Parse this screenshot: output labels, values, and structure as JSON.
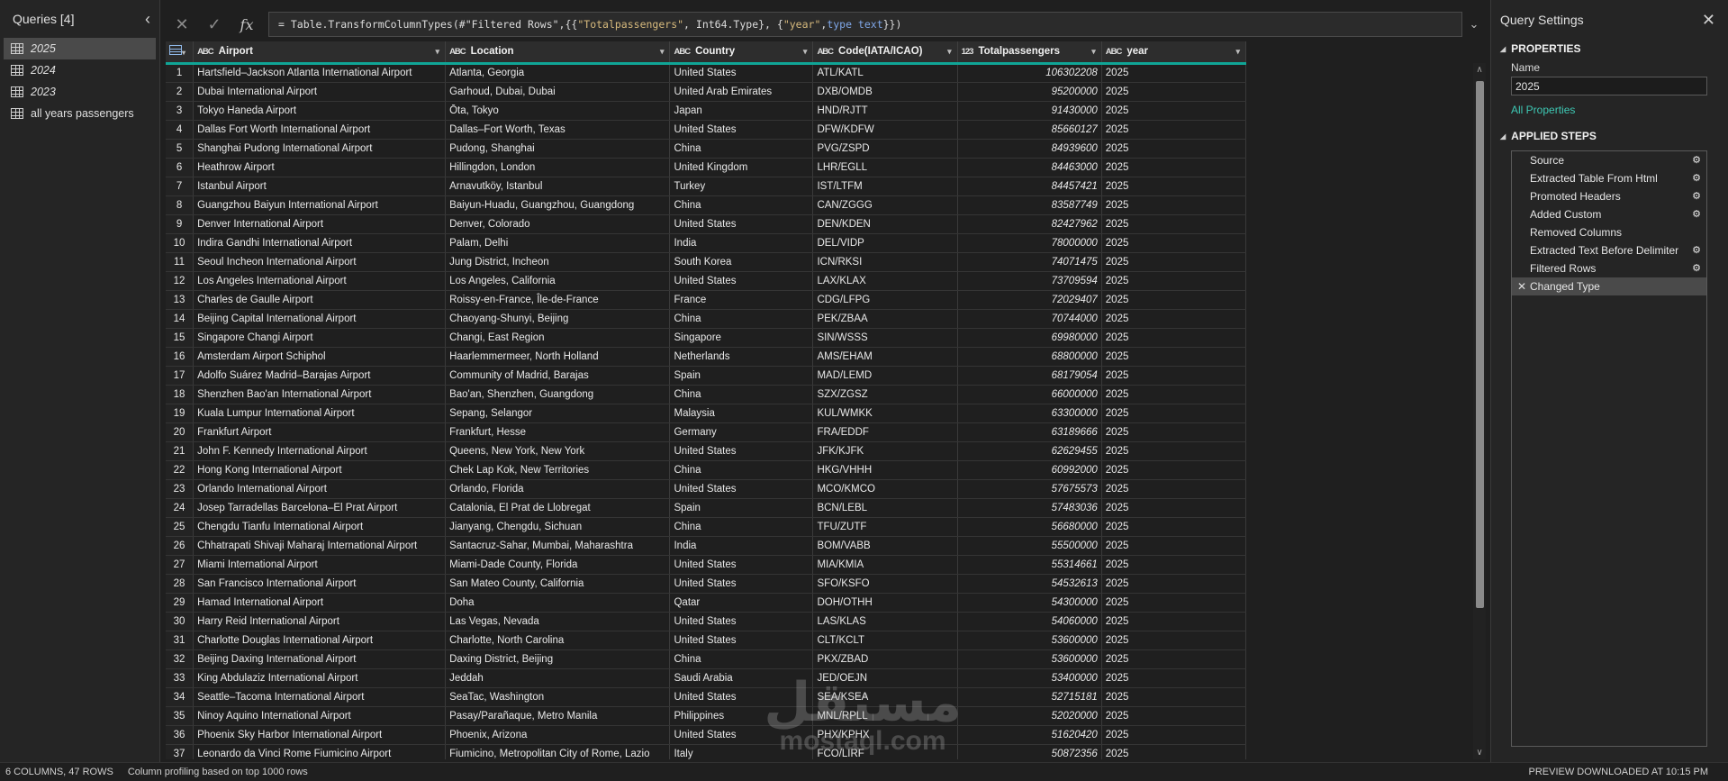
{
  "queries_pane": {
    "title": "Queries [4]",
    "items": [
      {
        "label": "2025",
        "selected": true
      },
      {
        "label": "2024",
        "selected": false
      },
      {
        "label": "2023",
        "selected": false
      },
      {
        "label": "all years passengers",
        "selected": false
      }
    ]
  },
  "formula_bar": {
    "cancel_icon": "x-icon",
    "commit_icon": "check-icon",
    "fx_label": "fx",
    "formula_prefix": "= Table.TransformColumnTypes(#\"Filtered Rows\",{{",
    "formula_str1": "\"Totalpassengers\"",
    "formula_mid": ", Int64.Type}, {",
    "formula_str2": "\"year\"",
    "formula_sep": ", ",
    "formula_kw": "type text",
    "formula_suffix": "}})"
  },
  "columns": [
    {
      "type": "ABC",
      "name": "Airport"
    },
    {
      "type": "ABC",
      "name": "Location"
    },
    {
      "type": "ABC",
      "name": "Country"
    },
    {
      "type": "ABC",
      "name": "Code(IATA/ICAO)"
    },
    {
      "type": "123",
      "name": "Totalpassengers"
    },
    {
      "type": "ABC",
      "name": "year"
    }
  ],
  "rows": [
    [
      "1",
      "Hartsfield–Jackson Atlanta International Airport",
      "Atlanta, Georgia",
      "United States",
      "ATL/KATL",
      "106302208",
      "2025"
    ],
    [
      "2",
      "Dubai International Airport",
      "Garhoud, Dubai, Dubai",
      "United Arab Emirates",
      "DXB/OMDB",
      "95200000",
      "2025"
    ],
    [
      "3",
      "Tokyo Haneda Airport",
      "Ōta, Tokyo",
      "Japan",
      "HND/RJTT",
      "91430000",
      "2025"
    ],
    [
      "4",
      "Dallas Fort Worth International Airport",
      "Dallas–Fort Worth, Texas",
      "United States",
      "DFW/KDFW",
      "85660127",
      "2025"
    ],
    [
      "5",
      "Shanghai Pudong International Airport",
      "Pudong, Shanghai",
      "China",
      "PVG/ZSPD",
      "84939600",
      "2025"
    ],
    [
      "6",
      "Heathrow Airport",
      "Hillingdon, London",
      "United Kingdom",
      "LHR/EGLL",
      "84463000",
      "2025"
    ],
    [
      "7",
      "Istanbul Airport",
      "Arnavutköy, Istanbul",
      "Turkey",
      "IST/LTFM",
      "84457421",
      "2025"
    ],
    [
      "8",
      "Guangzhou Baiyun International Airport",
      "Baiyun-Huadu, Guangzhou, Guangdong",
      "China",
      "CAN/ZGGG",
      "83587749",
      "2025"
    ],
    [
      "9",
      "Denver International Airport",
      "Denver, Colorado",
      "United States",
      "DEN/KDEN",
      "82427962",
      "2025"
    ],
    [
      "10",
      "Indira Gandhi International Airport",
      "Palam, Delhi",
      "India",
      "DEL/VIDP",
      "78000000",
      "2025"
    ],
    [
      "11",
      "Seoul Incheon International Airport",
      "Jung District, Incheon",
      "South Korea",
      "ICN/RKSI",
      "74071475",
      "2025"
    ],
    [
      "12",
      "Los Angeles International Airport",
      "Los Angeles, California",
      "United States",
      "LAX/KLAX",
      "73709594",
      "2025"
    ],
    [
      "13",
      "Charles de Gaulle Airport",
      "Roissy-en-France, Île-de-France",
      "France",
      "CDG/LFPG",
      "72029407",
      "2025"
    ],
    [
      "14",
      "Beijing Capital International Airport",
      "Chaoyang-Shunyi, Beijing",
      "China",
      "PEK/ZBAA",
      "70744000",
      "2025"
    ],
    [
      "15",
      "Singapore Changi Airport",
      "Changi, East Region",
      "Singapore",
      "SIN/WSSS",
      "69980000",
      "2025"
    ],
    [
      "16",
      "Amsterdam Airport Schiphol",
      "Haarlemmermeer, North Holland",
      "Netherlands",
      "AMS/EHAM",
      "68800000",
      "2025"
    ],
    [
      "17",
      "Adolfo Suárez Madrid–Barajas Airport",
      "Community of Madrid, Barajas",
      "Spain",
      "MAD/LEMD",
      "68179054",
      "2025"
    ],
    [
      "18",
      "Shenzhen Bao'an International Airport",
      "Bao'an, Shenzhen, Guangdong",
      "China",
      "SZX/ZGSZ",
      "66000000",
      "2025"
    ],
    [
      "19",
      "Kuala Lumpur International Airport",
      "Sepang, Selangor",
      "Malaysia",
      "KUL/WMKK",
      "63300000",
      "2025"
    ],
    [
      "20",
      "Frankfurt Airport",
      "Frankfurt, Hesse",
      "Germany",
      "FRA/EDDF",
      "63189666",
      "2025"
    ],
    [
      "21",
      "John F. Kennedy International Airport",
      "Queens, New York, New York",
      "United States",
      "JFK/KJFK",
      "62629455",
      "2025"
    ],
    [
      "22",
      "Hong Kong International Airport",
      "Chek Lap Kok, New Territories",
      "China",
      "HKG/VHHH",
      "60992000",
      "2025"
    ],
    [
      "23",
      "Orlando International Airport",
      "Orlando, Florida",
      "United States",
      "MCO/KMCO",
      "57675573",
      "2025"
    ],
    [
      "24",
      "Josep Tarradellas Barcelona–El Prat Airport",
      "Catalonia, El Prat de Llobregat",
      "Spain",
      "BCN/LEBL",
      "57483036",
      "2025"
    ],
    [
      "25",
      "Chengdu Tianfu International Airport",
      "Jianyang, Chengdu, Sichuan",
      "China",
      "TFU/ZUTF",
      "56680000",
      "2025"
    ],
    [
      "26",
      "Chhatrapati Shivaji Maharaj International Airport",
      "Santacruz-Sahar, Mumbai, Maharashtra",
      "India",
      "BOM/VABB",
      "55500000",
      "2025"
    ],
    [
      "27",
      "Miami International Airport",
      "Miami-Dade County, Florida",
      "United States",
      "MIA/KMIA",
      "55314661",
      "2025"
    ],
    [
      "28",
      "San Francisco International Airport",
      "San Mateo County, California",
      "United States",
      "SFO/KSFO",
      "54532613",
      "2025"
    ],
    [
      "29",
      "Hamad International Airport",
      "Doha",
      "Qatar",
      "DOH/OTHH",
      "54300000",
      "2025"
    ],
    [
      "30",
      "Harry Reid International Airport",
      "Las Vegas, Nevada",
      "United States",
      "LAS/KLAS",
      "54060000",
      "2025"
    ],
    [
      "31",
      "Charlotte Douglas International Airport",
      "Charlotte, North Carolina",
      "United States",
      "CLT/KCLT",
      "53600000",
      "2025"
    ],
    [
      "32",
      "Beijing Daxing International Airport",
      "Daxing District, Beijing",
      "China",
      "PKX/ZBAD",
      "53600000",
      "2025"
    ],
    [
      "33",
      "King Abdulaziz International Airport",
      "Jeddah",
      "Saudi Arabia",
      "JED/OEJN",
      "53400000",
      "2025"
    ],
    [
      "34",
      "Seattle–Tacoma International Airport",
      "SeaTac, Washington",
      "United States",
      "SEA/KSEA",
      "52715181",
      "2025"
    ],
    [
      "35",
      "Ninoy Aquino International Airport",
      "Pasay/Parañaque, Metro Manila",
      "Philippines",
      "MNL/RPLL",
      "52020000",
      "2025"
    ],
    [
      "36",
      "Phoenix Sky Harbor International Airport",
      "Phoenix, Arizona",
      "United States",
      "PHX/KPHX",
      "51620420",
      "2025"
    ],
    [
      "37",
      "Leonardo da Vinci Rome Fiumicino Airport",
      "Fiumicino, Metropolitan City of Rome, Lazio",
      "Italy",
      "FCO/LIRF",
      "50872356",
      "2025"
    ]
  ],
  "settings": {
    "title": "Query Settings",
    "properties_title": "PROPERTIES",
    "name_label": "Name",
    "name_value": "2025",
    "all_properties_link": "All Properties",
    "applied_steps_title": "APPLIED STEPS",
    "steps": [
      {
        "label": "Source",
        "gear": true,
        "active": false
      },
      {
        "label": "Extracted Table From Html",
        "gear": true,
        "active": false
      },
      {
        "label": "Promoted Headers",
        "gear": true,
        "active": false
      },
      {
        "label": "Added Custom",
        "gear": true,
        "active": false
      },
      {
        "label": "Removed Columns",
        "gear": false,
        "active": false
      },
      {
        "label": "Extracted Text Before Delimiter",
        "gear": true,
        "active": false
      },
      {
        "label": "Filtered Rows",
        "gear": true,
        "active": false
      },
      {
        "label": "Changed Type",
        "gear": false,
        "active": true
      }
    ]
  },
  "status_bar": {
    "counts": "6 COLUMNS, 47 ROWS",
    "profiling": "Column profiling based on top 1000 rows",
    "preview": "PREVIEW DOWNLOADED AT 10:15 PM"
  },
  "watermark": {
    "arabic": "مستقل",
    "latin": "mostaql.com"
  },
  "colors": {
    "accent_teal": "#10a596",
    "link": "#3ec8b4",
    "background": "#1f1f1f"
  }
}
